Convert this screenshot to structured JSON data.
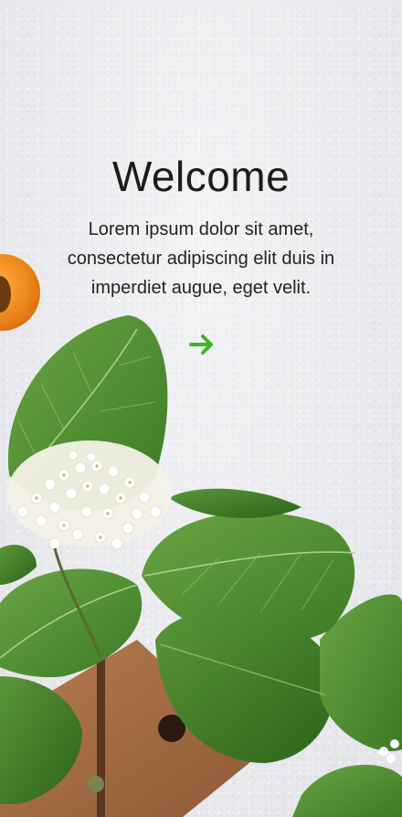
{
  "welcome": {
    "title": "Welcome",
    "body": "Lorem ipsum dolor sit amet, consectetur adipiscing elit duis in imperdiet augue, eget velit."
  },
  "next_button": {
    "icon": "arrow-right-icon",
    "color": "#3fb52a"
  },
  "colors": {
    "background": "#eceef0",
    "leaf": "#4c8a2f",
    "leaf_dark": "#2f6a1e",
    "orange": "#f08a1c",
    "wood": "#a8704a"
  }
}
